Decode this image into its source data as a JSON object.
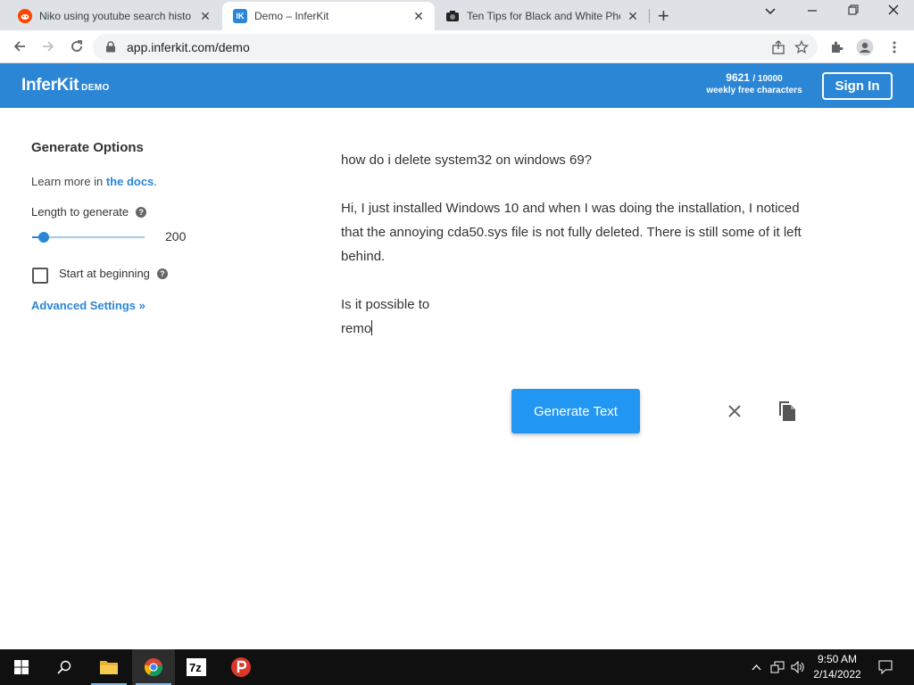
{
  "browser": {
    "tabs": [
      {
        "title": "Niko using youtube search histo",
        "favicon": "reddit-icon",
        "active": false
      },
      {
        "title": "Demo – InferKit",
        "favicon": "inferkit-icon",
        "active": true
      },
      {
        "title": "Ten Tips for Black and White Pho",
        "favicon": "camera-icon",
        "active": false
      }
    ],
    "url": "app.inferkit.com/demo",
    "favicon_text": "IK"
  },
  "header": {
    "logo": "InferKit",
    "logo_badge": "DEMO",
    "credits_used": "9621",
    "credits_total": "/ 10000",
    "credits_label": "weekly free characters",
    "signin_label": "Sign In",
    "brand_color": "#2b86d6"
  },
  "options": {
    "title": "Generate Options",
    "learn_prefix": "Learn more in ",
    "learn_link": "the docs",
    "learn_suffix": ".",
    "length_label": "Length to generate",
    "length_value": "200",
    "length_slider_fraction": 0.1,
    "start_label": "Start at beginning",
    "start_checked": false,
    "advanced_label": "Advanced Settings »"
  },
  "editor": {
    "line1": "how do i delete system32 on windows 69?",
    "para2": "Hi, I just installed Windows 10 and when I was doing the installation, I noticed that the annoying cda50.sys file is not fully deleted. There is still some of it left behind.",
    "line3": "Is it possible to",
    "line4": "remo"
  },
  "actions": {
    "generate_label": "Generate Text",
    "generate_color": "#2196f3"
  },
  "taskbar": {
    "time": "9:50 AM",
    "date": "2/14/2022"
  }
}
